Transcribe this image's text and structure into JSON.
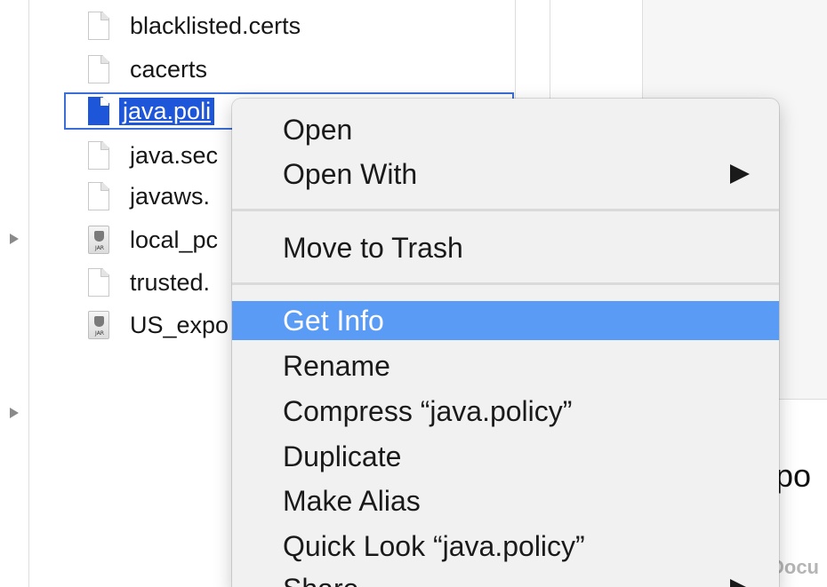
{
  "files": [
    {
      "name": "blacklisted.certs",
      "icon": "document-icon"
    },
    {
      "name": "cacerts",
      "icon": "document-icon"
    },
    {
      "name": "java.poli",
      "icon": "document-icon",
      "selected": true
    },
    {
      "name": "java.sec",
      "icon": "document-icon"
    },
    {
      "name": "javaws.",
      "icon": "document-icon"
    },
    {
      "name": "local_pc",
      "icon": "jar-icon"
    },
    {
      "name": "trusted.",
      "icon": "document-icon"
    },
    {
      "name": "US_expo",
      "icon": "jar-icon"
    }
  ],
  "jar_label": "JAR",
  "preview": {
    "partial_title": ".po",
    "partial_kind": "Docu"
  },
  "context_menu": {
    "items": [
      {
        "label": "Open",
        "submenu": false,
        "highlighted": false
      },
      {
        "label": "Open With",
        "submenu": true,
        "highlighted": false
      },
      {
        "label": "Move to Trash",
        "submenu": false,
        "highlighted": false
      },
      {
        "label": "Get Info",
        "submenu": false,
        "highlighted": true
      },
      {
        "label": "Rename",
        "submenu": false,
        "highlighted": false
      },
      {
        "label": "Compress “java.policy”",
        "submenu": false,
        "highlighted": false
      },
      {
        "label": "Duplicate",
        "submenu": false,
        "highlighted": false
      },
      {
        "label": "Make Alias",
        "submenu": false,
        "highlighted": false
      },
      {
        "label": "Quick Look “java.policy”",
        "submenu": false,
        "highlighted": false
      },
      {
        "label": "Share",
        "submenu": true,
        "highlighted": false
      }
    ]
  },
  "colors": {
    "selection_blue": "#1d56d8",
    "menu_highlight": "#5a9bf6",
    "menu_background": "#f1f1f1"
  }
}
